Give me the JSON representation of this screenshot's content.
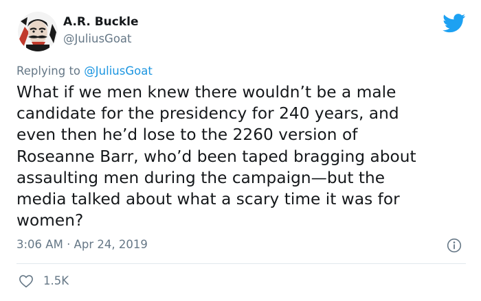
{
  "tweet": {
    "author": {
      "display_name": "A.R. Buckle",
      "handle": "@JuliusGoat"
    },
    "reply": {
      "prefix": "Replying to",
      "mention": "@JuliusGoat"
    },
    "text": "What if we men knew there wouldn’t be a male\ncandidate for the presidency for 240 years, and\neven then he’d lose to the 2260 version of\nRoseanne Barr, who’d been taped bragging about\nassaulting men during the campaign—but the\nmedia talked about what a scary time it was for\nwomen?",
    "timestamp": "3:06 AM · Apr 24, 2019",
    "likes": "1.5K"
  },
  "icons": {
    "brand": "twitter-bird-icon",
    "info": "info-icon",
    "like": "heart-icon"
  },
  "colors": {
    "brand_blue": "#1da1f2",
    "link_blue": "#1b95e0",
    "secondary_text": "#657786",
    "primary_text": "#14171a",
    "divider": "#e1e8ed"
  }
}
